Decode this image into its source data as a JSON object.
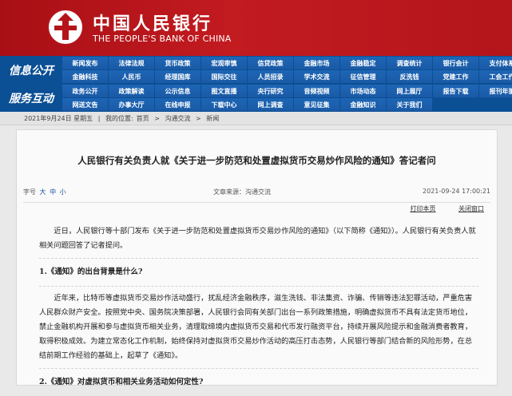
{
  "header": {
    "name_cn": "中国人民银行",
    "name_en": "THE PEOPLE'S BANK OF CHINA"
  },
  "nav": {
    "block1_label": "信息公开",
    "block2_label": "服务互动",
    "row1": [
      "新闻发布",
      "法律法规",
      "货币政策",
      "宏观审慎",
      "信贷政策",
      "金融市场",
      "金融稳定",
      "调查统计",
      "银行会计",
      "支付体系"
    ],
    "row2": [
      "金融科技",
      "人民币",
      "经理国库",
      "国际交往",
      "人员招录",
      "学术交流",
      "征信管理",
      "反洗钱",
      "党建工作",
      "工会工作"
    ],
    "row3": [
      "政务公开",
      "政策解读",
      "公示信息",
      "图文直播",
      "央行研究",
      "音频视频",
      "市场动态",
      "网上展厅",
      "报告下载",
      "报刊年鉴"
    ],
    "row4": [
      "网送文告",
      "办事大厅",
      "在线申报",
      "下载中心",
      "网上调查",
      "意见征集",
      "金融知识",
      "关于我们",
      "",
      ""
    ]
  },
  "breadcrumb": {
    "date": "2021年9月24日 星期五",
    "position_label": "我的位置:",
    "path": [
      "首页",
      "沟通交流",
      "新闻"
    ]
  },
  "article": {
    "title": "人民银行有关负责人就《关于进一步防范和处置虚拟货币交易炒作风险的通知》答记者问",
    "font_size_label": "字号",
    "font_sizes": [
      "大",
      "中",
      "小"
    ],
    "source": "文章来源：沟通交流",
    "datetime": "2021-09-24 17:00:21",
    "print_label": "打印本页",
    "close_label": "关闭窗口",
    "intro": "近日，人民银行等十部门发布《关于进一步防范和处置虚拟货币交易炒作风险的通知》（以下简称《通知》）。人民银行有关负责人就相关问题回答了记者提问。",
    "q1": "1.《通知》的出台背景是什么?",
    "a1": "近年来，比特币等虚拟货币交易炒作活动盛行，扰乱经济金融秩序，滋生洗钱、非法集资、诈骗、传销等违法犯罪活动，严重危害人民群众财产安全。按照党中央、国务院决策部署，人民银行会同有关部门出台一系列政策措施，明确虚拟货币不具有法定货币地位，禁止金融机构开展和参与虚拟货币相关业务，清理取缔境内虚拟货币交易和代币发行融资平台，持续开展风险提示和金融消费者教育，取得积极成效。为建立常态化工作机制，始终保持对虚拟货币交易炒作活动的高压打击态势，人民银行等部门结合新的风险形势，在总结前期工作经验的基础上，起草了《通知》。",
    "q2": "2.《通知》对虚拟货币和相关业务活动如何定性?"
  },
  "colors": {
    "header_red": "#b4141a",
    "nav_blue": "#0b4f95",
    "link_blue": "#1a4fa0"
  }
}
